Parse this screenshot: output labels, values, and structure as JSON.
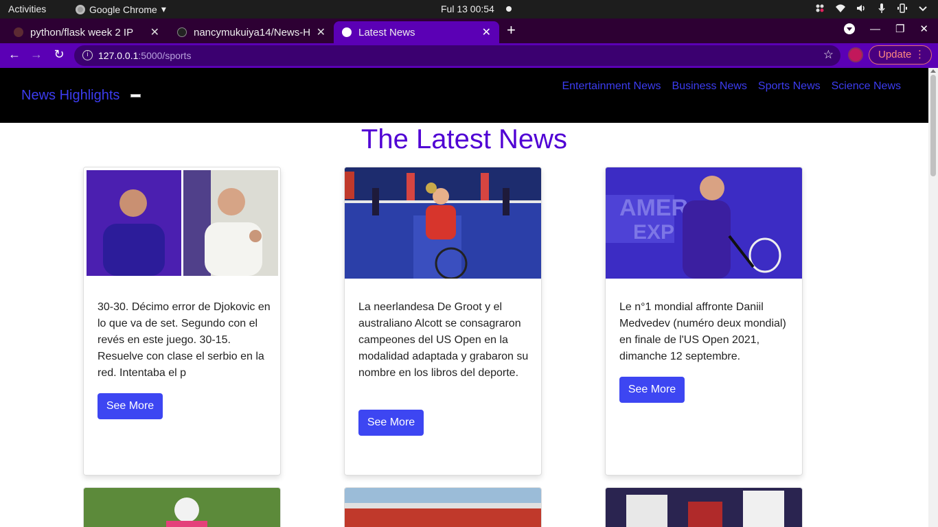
{
  "os_bar": {
    "activities": "Activities",
    "app_name": "Google Chrome",
    "clock": "Ful 13  00:54"
  },
  "tabs": [
    {
      "label": "python/flask week 2 IP",
      "favicon_color": "#5c2a33"
    },
    {
      "label": "nancymukuiya14/News-H",
      "favicon_color": "#222222"
    },
    {
      "label": "Latest News",
      "favicon_color": "#ffffff",
      "active": true
    }
  ],
  "toolbar": {
    "url_host": "127.0.0.1",
    "url_path": ":5000/sports",
    "update_label": "Update"
  },
  "site": {
    "brand": "News Highlights",
    "nav_links": [
      "Entertainment News",
      "Business News",
      "Sports News",
      "Science News"
    ],
    "title": "The Latest News"
  },
  "articles": [
    {
      "description": "30-30. Décimo error de Djokovic en lo que va de set. Segundo con el revés en este juego. 30-15. Resuelve con clase el serbio en la red. Intentaba el p",
      "button_label": "See More"
    },
    {
      "description": "La neerlandesa De Groot y el australiano Alcott se consagraron campeones del US Open en la modalidad adaptada y grabaron su nombre en los libros del deporte.",
      "button_label": "See More"
    },
    {
      "description": "Le n°1 mondial affronte Daniil Medvedev (numéro deux mondial) en finale de l'US Open 2021, dimanche 12 septembre.",
      "button_label": "See More"
    }
  ],
  "colors": {
    "accent": "#5b00b5",
    "link": "#3c3cf0",
    "title": "#5000d4",
    "button": "#3d46f2"
  }
}
